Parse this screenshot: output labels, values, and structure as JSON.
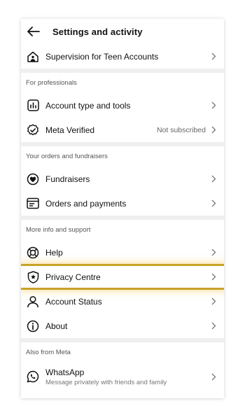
{
  "header": {
    "title": "Settings and activity"
  },
  "top_items": [
    {
      "label": "Supervision for Teen Accounts",
      "icon": "teen-supervision-icon"
    }
  ],
  "sections": [
    {
      "heading": "For professionals",
      "items": [
        {
          "label": "Account type and tools",
          "icon": "bar-chart-icon"
        },
        {
          "label": "Meta Verified",
          "icon": "verified-badge-icon",
          "status": "Not subscribed"
        }
      ]
    },
    {
      "heading": "Your orders and fundraisers",
      "items": [
        {
          "label": "Fundraisers",
          "icon": "heart-coin-icon"
        },
        {
          "label": "Orders and payments",
          "icon": "receipt-icon"
        }
      ]
    },
    {
      "heading": "More info and support",
      "items": [
        {
          "label": "Help",
          "icon": "lifebuoy-icon"
        },
        {
          "label": "Privacy Centre",
          "icon": "shield-star-icon"
        },
        {
          "label": "Account Status",
          "icon": "person-icon"
        },
        {
          "label": "About",
          "icon": "info-icon"
        }
      ]
    },
    {
      "heading": "Also from Meta",
      "items": [
        {
          "label": "WhatsApp",
          "icon": "whatsapp-icon",
          "subtitle": "Message privately with friends and family"
        }
      ]
    }
  ],
  "colors": {
    "highlight": "#c9a227",
    "divider": "#efefef"
  }
}
